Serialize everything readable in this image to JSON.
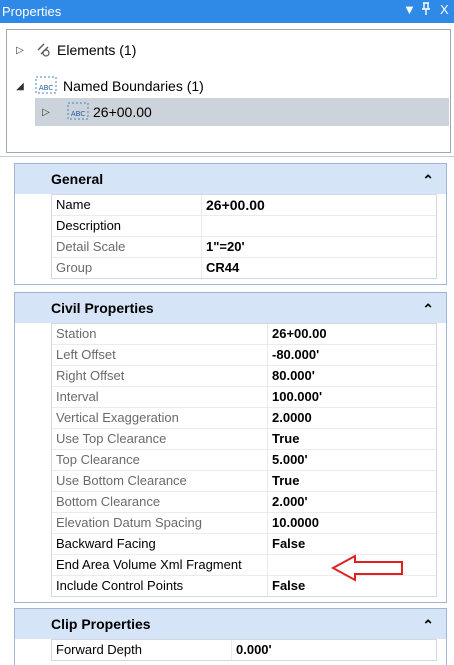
{
  "window": {
    "title": "Properties",
    "ctrl_dropdown": "▼",
    "ctrl_pin": " Ͱ",
    "ctrl_close": "X"
  },
  "tree": {
    "items": [
      {
        "label": "Elements (1)",
        "expander": "▷"
      },
      {
        "label": "Named Boundaries (1)",
        "expander": "◢"
      },
      {
        "label": "26+00.00",
        "expander": "▷"
      }
    ]
  },
  "general": {
    "title": "General",
    "rows": [
      {
        "label": "Name",
        "value": "26+00.00"
      },
      {
        "label": "Description",
        "value": ""
      },
      {
        "label": "Detail Scale",
        "value": "1\"=20'"
      },
      {
        "label": "Group",
        "value": "CR44"
      }
    ]
  },
  "civil": {
    "title": "Civil Properties",
    "rows": [
      {
        "label": "Station",
        "value": "26+00.00"
      },
      {
        "label": "Left Offset",
        "value": "-80.000'"
      },
      {
        "label": "Right Offset",
        "value": "80.000'"
      },
      {
        "label": "Interval",
        "value": "100.000'"
      },
      {
        "label": "Vertical Exaggeration",
        "value": "2.0000"
      },
      {
        "label": "Use Top Clearance",
        "value": "True"
      },
      {
        "label": "Top Clearance",
        "value": "5.000'"
      },
      {
        "label": "Use Bottom Clearance",
        "value": "True"
      },
      {
        "label": "Bottom Clearance",
        "value": "2.000'"
      },
      {
        "label": "Elevation Datum Spacing",
        "value": "10.0000"
      },
      {
        "label": "Backward Facing",
        "value": "False"
      },
      {
        "label": "End Area Volume Xml Fragment",
        "value": ""
      },
      {
        "label": "Include Control Points",
        "value": "False"
      }
    ]
  },
  "clip": {
    "title": "Clip Properties",
    "rows": [
      {
        "label": "Forward Depth",
        "value": "0.000'"
      }
    ]
  },
  "colors": {
    "titlebar": "#2e8ae6",
    "group_header": "#d5e4f7",
    "selection": "#cdd3da",
    "arrow": "#e02020"
  },
  "icons": {
    "elements": "elements-icon",
    "boundary": "named-boundary-icon",
    "collapse": "chevron-up-icon"
  }
}
